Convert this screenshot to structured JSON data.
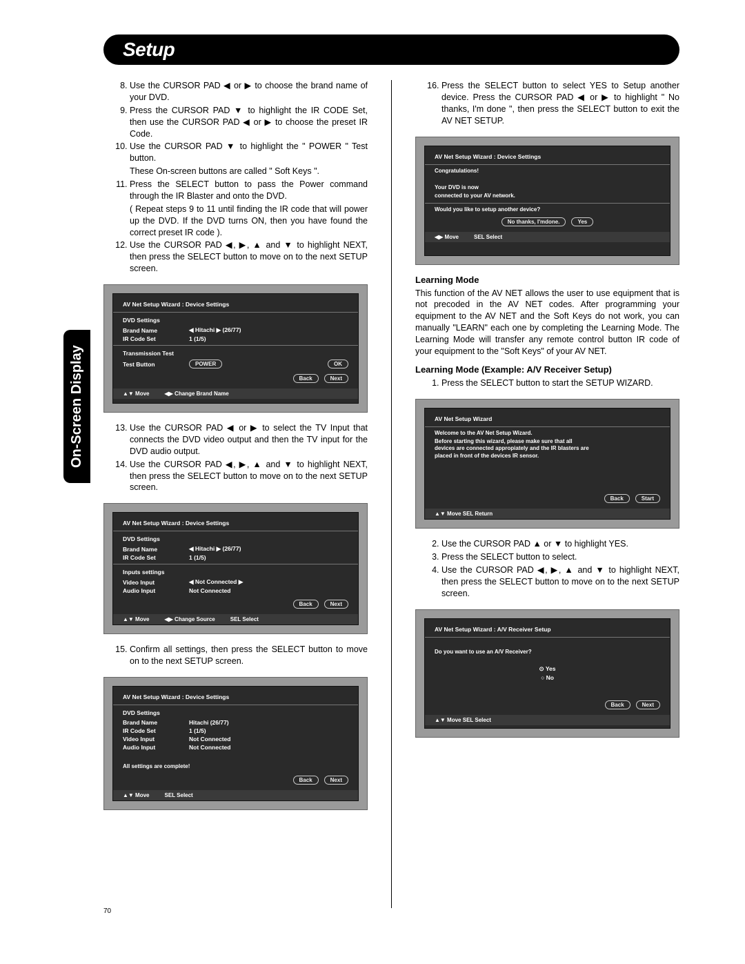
{
  "header": {
    "title": "Setup"
  },
  "vtab": "On-Screen Display",
  "pagenum": "70",
  "left": {
    "steps": [
      {
        "n": 8,
        "text": "Use the CURSOR PAD ◀ or ▶ to choose the brand name of your DVD."
      },
      {
        "n": 9,
        "text": "Press the CURSOR PAD ▼ to highlight the IR CODE Set, then use the CURSOR PAD ◀ or ▶ to choose the preset IR Code."
      },
      {
        "n": 10,
        "text": "Use the CURSOR PAD ▼ to highlight the \" POWER \" Test button.",
        "sub": "These On-screen buttons are called \" Soft Keys \"."
      },
      {
        "n": 11,
        "text": "Press the SELECT button to pass the Power command through the IR Blaster and onto the DVD.",
        "sub": "( Repeat steps 9 to 11 until finding the IR code that will power up the DVD. If the DVD turns ON, then you have found the correct preset IR code )."
      },
      {
        "n": 12,
        "text": "Use the CURSOR PAD ◀, ▶, ▲ and ▼ to highlight NEXT, then press the SELECT button to move on to the next SETUP screen."
      }
    ],
    "steps2": [
      {
        "n": 13,
        "text": "Use the CURSOR PAD ◀ or ▶ to select the TV Input that connects the DVD video output and then the TV input for the DVD audio output."
      },
      {
        "n": 14,
        "text": "Use the CURSOR PAD ◀, ▶, ▲ and ▼ to highlight NEXT, then press the SELECT button to move on to the next SETUP screen."
      }
    ],
    "steps3": [
      {
        "n": 15,
        "text": "Confirm all settings, then  press the SELECT button to move on to the next SETUP screen."
      }
    ],
    "screen1": {
      "title": "AV Net Setup Wizard : Device Settings",
      "section1": "DVD Settings",
      "rows1": [
        {
          "label": "Brand Name",
          "value": "◀  Hitachi  ▶  (26/77)"
        },
        {
          "label": "IR Code Set",
          "value": "1        (1/5)"
        }
      ],
      "section2": "Transmission Test",
      "rows2": [
        {
          "label": "Test Button",
          "btn1": "POWER",
          "btn2": "OK"
        }
      ],
      "nav": [
        "Back",
        "Next"
      ],
      "foot": [
        "▲▼  Move",
        "◀▶ Change Brand Name"
      ]
    },
    "screen2": {
      "title": "AV Net Setup Wizard : Device Settings",
      "section1": "DVD Settings",
      "rows1": [
        {
          "label": "Brand Name",
          "value": "◀  Hitachi  ▶  (26/77)"
        },
        {
          "label": "IR Code Set",
          "value": "1        (1/5)"
        }
      ],
      "section2": "Inputs settings",
      "rows2": [
        {
          "label": "Video Input",
          "value": "◀ Not Connected ▶"
        },
        {
          "label": "Audio Input",
          "value": "Not Connected"
        }
      ],
      "nav": [
        "Back",
        "Next"
      ],
      "foot": [
        "▲▼  Move",
        "◀▶ Change Source",
        "SEL Select"
      ]
    },
    "screen3": {
      "title": "AV Net Setup Wizard : Device Settings",
      "section1": "DVD Settings",
      "rows1": [
        {
          "label": "Brand Name",
          "value": "Hitachi       (26/77)"
        },
        {
          "label": "IR Code Set",
          "value": "1    (1/5)"
        },
        {
          "label": "Video Input",
          "value": "Not Connected"
        },
        {
          "label": "Audio Input",
          "value": "Not Connected"
        }
      ],
      "msg": "All settings are complete!",
      "nav": [
        "Back",
        "Next"
      ],
      "foot": [
        "▲▼  Move",
        "SEL Select"
      ]
    }
  },
  "right": {
    "steps": [
      {
        "n": 16,
        "text": "Press the SELECT button to select YES to Setup another device.  Press the CURSOR PAD ◀ or ▶ to highlight \" No thanks, I'm done \",  then press the SELECT button to exit the AV NET SETUP."
      }
    ],
    "screen4": {
      "title": "AV Net Setup Wizard : Device Settings",
      "line1": "Congratulations!",
      "line2": "Your DVD is now",
      "line3": "connected to your AV network.",
      "q": "Would you like to setup another device?",
      "btns": [
        "No thanks, I'mdone.",
        "Yes"
      ],
      "foot": [
        "◀▶ Move",
        "SEL Select"
      ]
    },
    "learning_head": "Learning Mode",
    "learning_body": "This function of the AV NET allows the user to use equipment that is not precoded in the AV NET codes. After programming your equipment to the AV NET and the Soft Keys do not work, you can manually \"LEARN\" each one by completing the Learning Mode.  The Learning Mode will transfer any remote control button IR code of your equipment to the \"Soft Keys\" of your AV NET.",
    "learning_ex_head": "Learning Mode (Example: A/V Receiver Setup)",
    "steps2": [
      {
        "n": 1,
        "text": "Press the SELECT button to start the SETUP WIZARD."
      }
    ],
    "screen5": {
      "title": "AV Net Setup Wizard",
      "l1": "Welcome to the AV Net Setup Wizard.",
      "l2": "Before starting this wizard, please make sure that all devices are connected appropiately and the IR blasters are placed in front of the devices IR sensor.",
      "nav": [
        "Back",
        "Start"
      ],
      "foot": [
        "▲▼ Move SEL Return"
      ]
    },
    "steps3": [
      {
        "n": 2,
        "text": "Use the CURSOR PAD ▲ or ▼ to highlight YES."
      },
      {
        "n": 3,
        "text": "Press the SELECT button to select."
      },
      {
        "n": 4,
        "text": "Use the CURSOR PAD ◀, ▶, ▲ and ▼ to highlight NEXT, then press the SELECT button to move on to the next SETUP screen."
      }
    ],
    "screen6": {
      "title": "AV Net Setup Wizard : A/V Receiver Setup",
      "q": "Do you want to use an A/V Receiver?",
      "opts": [
        "Yes",
        "No"
      ],
      "nav": [
        "Back",
        "Next"
      ],
      "foot": [
        "▲▼ Move SEL Select"
      ]
    }
  }
}
